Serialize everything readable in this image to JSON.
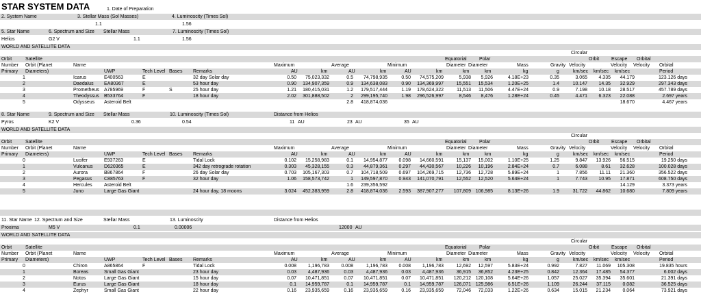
{
  "title": "STAR SYSTEM DATA",
  "date_label": "1. Date of Preparation",
  "sys_header": [
    "2. System Name",
    "3. Stellar Mass (Sol Masses)",
    "4. Luminoscity (Times Sol)"
  ],
  "sys_values": [
    "1.1",
    "1.56"
  ],
  "star_header": [
    "5. Star Name",
    "6. Spectrum and Size",
    "Stellar Mass",
    "7. Luminoscity (Times Sol)"
  ],
  "star_values": [
    "Helios",
    "G2 V",
    "1.1",
    "1.56"
  ],
  "world_title": "WORLD AND SATELLITE DATA",
  "col_headers": {
    "r1": [
      "Circular"
    ],
    "r2": [
      "Orbit",
      "Satellite",
      "Equatorial",
      "Polar",
      "Orbit",
      "Escape",
      "Orbital"
    ],
    "r3": [
      "Number",
      "Orbit (Planet",
      "Name",
      "Maximum",
      "Average",
      "Minimum",
      "Diameter",
      "Diameter",
      "Mass",
      "Gravity",
      "Velocity",
      "Velocity",
      "Velocity",
      "Orbital"
    ],
    "r4": [
      "Primary",
      "Diameters)",
      "UWP",
      "Tech Level",
      "Bases",
      "Remarks",
      "AU",
      "km",
      "AU",
      "km",
      "AU",
      "km",
      "km",
      "km",
      "kg",
      "g",
      "km/sec",
      "km/sec",
      "km/sec",
      "Period"
    ]
  },
  "system1": {
    "rows": [
      [
        "1",
        "Icarus",
        "E400563",
        "E",
        "",
        "32 day Solar day",
        "0.50",
        "75,023,332",
        "0.5",
        "74,798,935",
        "0.50",
        "74,575,209",
        "5,938",
        "5,926",
        "4.18E+23",
        "0.35",
        "3.065",
        "4.335",
        "44.179",
        "123.126 days"
      ],
      [
        "2",
        "Daedalus",
        "EA80367",
        "E",
        "",
        "53 hour day",
        "0.90",
        "134,907,359",
        "0.9",
        "134,638,083",
        "0.90",
        "134,369,997",
        "15,551",
        "15,534",
        "1.20E+25",
        "1.4",
        "10.147",
        "14.35",
        "32.929",
        "297.343 days"
      ],
      [
        "3",
        "Prometheus",
        "A785969",
        "F",
        "S",
        "25 hour day",
        "1.21",
        "180,415,031",
        "1.2",
        "179,517,444",
        "1.19",
        "178,624,322",
        "11,513",
        "11,506",
        "4.47E+24",
        "0.9",
        "7.198",
        "10.18",
        "28.517",
        "457.789 days"
      ],
      [
        "4",
        "Theodyssus",
        "B533764",
        "F",
        "",
        "18 hour day",
        "2.02",
        "301,888,502",
        "2",
        "299,195,740",
        "1.98",
        "296,526,997",
        "8,546",
        "8,476",
        "1.28E+24",
        "0.45",
        "4.471",
        "6.323",
        "22.088",
        "2.697 years"
      ],
      [
        "5",
        "Odysseus",
        "Asteroid Belt",
        "",
        "",
        "",
        "",
        "",
        "2.8",
        "418,874,036",
        "",
        "",
        "",
        "",
        "",
        "",
        "",
        "",
        "18.670",
        "4.467 years"
      ]
    ]
  },
  "star2_header": [
    "8. Star Name",
    "9. Spectrum and Size",
    "Stellar Mass",
    "10. Luminoscity (Times Sol)",
    "Distance from Helios"
  ],
  "star2_values": [
    "Pyros",
    "K2 V",
    "0.36",
    "0.54",
    "11",
    "AU",
    "23",
    "AU",
    "35",
    "AU"
  ],
  "system2": {
    "rows": [
      [
        "0",
        "Lucifer",
        "E937263",
        "E",
        "",
        "Tidal Lock",
        "0.102",
        "15,258,983",
        "0.1",
        "14,954,877",
        "0.098",
        "14,660,591",
        "15,137",
        "15,002",
        "1.10E+25",
        "1.25",
        "9.847",
        "13.926",
        "56.515",
        "19.250 days"
      ],
      [
        "1",
        "Vulcanus",
        "D620365",
        "E",
        "",
        "342 day retrograde rotation",
        "0.303",
        "45,328,155",
        "0.3",
        "44,879,361",
        "0.297",
        "44,430,567",
        "10,226",
        "10,196",
        "2.84E+24",
        "0.7",
        "6.088",
        "8.61",
        "32.628",
        "100.028 days"
      ],
      [
        "2",
        "Aurora",
        "B867864",
        "F",
        "",
        "26 day Solar day",
        "0.703",
        "105,167,303",
        "0.7",
        "104,718,509",
        "0.697",
        "104,269,715",
        "12,736",
        "12,728",
        "5.89E+24",
        "1",
        "7.856",
        "11.11",
        "21.360",
        "356.522 days"
      ],
      [
        "3",
        "Pegasus",
        "C885763",
        "F",
        "",
        "32 hour day",
        "1.06",
        "158,573,742",
        "1",
        "149,597,870",
        "0.943",
        "141,070,791",
        "12,552",
        "12,520",
        "5.64E+24",
        "1",
        "7.743",
        "10.95",
        "17.871",
        "608.750 days"
      ],
      [
        "4",
        "Hercules",
        "Asteroid Belt",
        "",
        "",
        "",
        "",
        "",
        "1.6",
        "239,356,592",
        "",
        "",
        "",
        "",
        "",
        "",
        "",
        "",
        "14.129",
        "3.373 years"
      ],
      [
        "5",
        "Juno",
        "Large Gas Giant",
        "",
        "",
        "24 hour day, 18 moons",
        "3.024",
        "452,383,959",
        "2.8",
        "418,874,036",
        "2.593",
        "387,907,277",
        "107,809",
        "106,985",
        "8.13E+26",
        "1.9",
        "31.722",
        "44.862",
        "10.680",
        "7.809 years"
      ]
    ]
  },
  "star3_header": [
    "11. Star Name",
    "12. Spectrum and Size",
    "Stellar Mass",
    "13. Luminoscity",
    "Distance from Helios"
  ],
  "star3_values": [
    "Proxima",
    "M5 V",
    "0.1",
    "0.00006",
    "12000",
    "AU"
  ],
  "system3": {
    "rows": [
      [
        "0",
        "Chiron",
        "A865864",
        "F",
        "",
        "Tidal Lock",
        "0.008",
        "1,196,783",
        "0.008",
        "1,196,783",
        "0.008",
        "1,196,783",
        "12,692",
        "12,597",
        "5.83E+24",
        "0.992",
        "7.827",
        "11.069",
        "105.308",
        "19.835 hours"
      ],
      [
        "1",
        "Boreas",
        "Small Gas Giant",
        "",
        "",
        "23 hour day",
        "0.03",
        "4,487,936",
        "0.03",
        "4,487,936",
        "0.03",
        "4,487,936",
        "36,915",
        "36,852",
        "4.23E+25",
        "0.842",
        "12.364",
        "17.485",
        "54.377",
        "6.002 days"
      ],
      [
        "2",
        "Notos",
        "Large Gas Giant",
        "",
        "",
        "15 hour day",
        "0.07",
        "10,471,851",
        "0.07",
        "10,471,851",
        "0.07",
        "10,471,851",
        "120,212",
        "120,108",
        "5.64E+26",
        "1.057",
        "25.027",
        "35.394",
        "35.601",
        "21.391 days"
      ],
      [
        "3",
        "Eurus",
        "Large Gas Giant",
        "",
        "",
        "18 hour day",
        "0.1",
        "14,959,787",
        "0.1",
        "14,959,787",
        "0.1",
        "14,959,787",
        "126,071",
        "125,986",
        "6.51E+26",
        "1.109",
        "26.244",
        "37.115",
        "0.082",
        "36.525 days"
      ],
      [
        "4",
        "Zephyr",
        "Small Gas Giant",
        "",
        "",
        "22 hour day",
        "0.16",
        "23,935,659",
        "0.16",
        "23,935,659",
        "0.16",
        "23,935,659",
        "72,046",
        "72,033",
        "1.22E+26",
        "0.634",
        "15.015",
        "21.234",
        "0.064",
        "73.921 days"
      ]
    ]
  }
}
